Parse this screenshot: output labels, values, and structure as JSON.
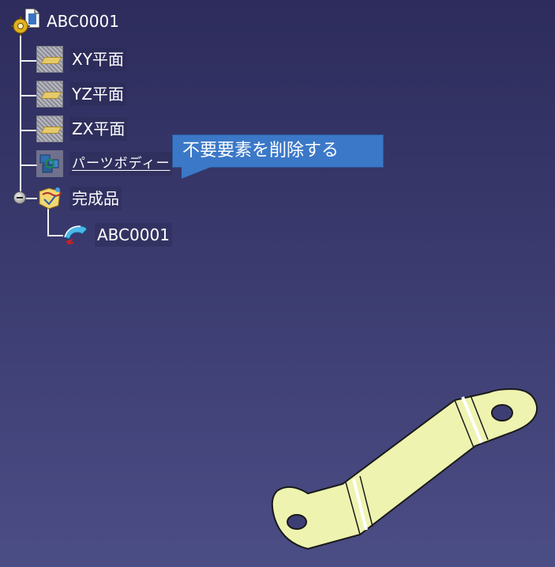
{
  "tree": {
    "root": {
      "label": "ABC0001",
      "icon": "part-document-gear-icon"
    },
    "items": [
      {
        "label": "XY平面",
        "icon": "plane-icon"
      },
      {
        "label": "YZ平面",
        "icon": "plane-icon"
      },
      {
        "label": "ZX平面",
        "icon": "plane-icon"
      },
      {
        "label": "パーツボディー",
        "icon": "part-body-icon"
      },
      {
        "label": "完成品",
        "icon": "geometrical-set-icon"
      }
    ],
    "child": {
      "label": "ABC0001",
      "icon": "solid-feature-icon"
    }
  },
  "callout": {
    "text": "不要要素を削除する"
  },
  "colors": {
    "background_top": "#2d2c5c",
    "background_bottom": "#4b4d85",
    "callout": "#3b78c8",
    "part_fill": "#eef3b0"
  }
}
